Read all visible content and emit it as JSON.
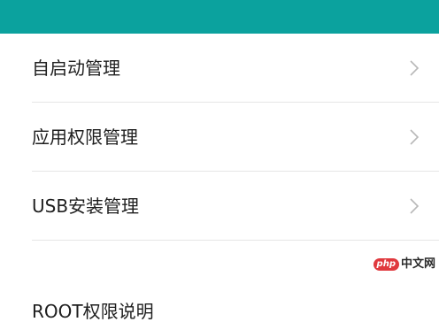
{
  "header": {
    "bg_color": "#0ba29e"
  },
  "list": {
    "items": [
      {
        "label": "自启动管理",
        "icon": "chevron-right-icon"
      },
      {
        "label": "应用权限管理",
        "icon": "chevron-right-icon"
      },
      {
        "label": "USB安装管理",
        "icon": "chevron-right-icon"
      },
      {
        "label": "ROOT权限说明",
        "icon": "chevron-right-icon"
      }
    ]
  },
  "watermark": {
    "brand": "php",
    "text": "中文网",
    "brand_color": "#e0393e"
  }
}
